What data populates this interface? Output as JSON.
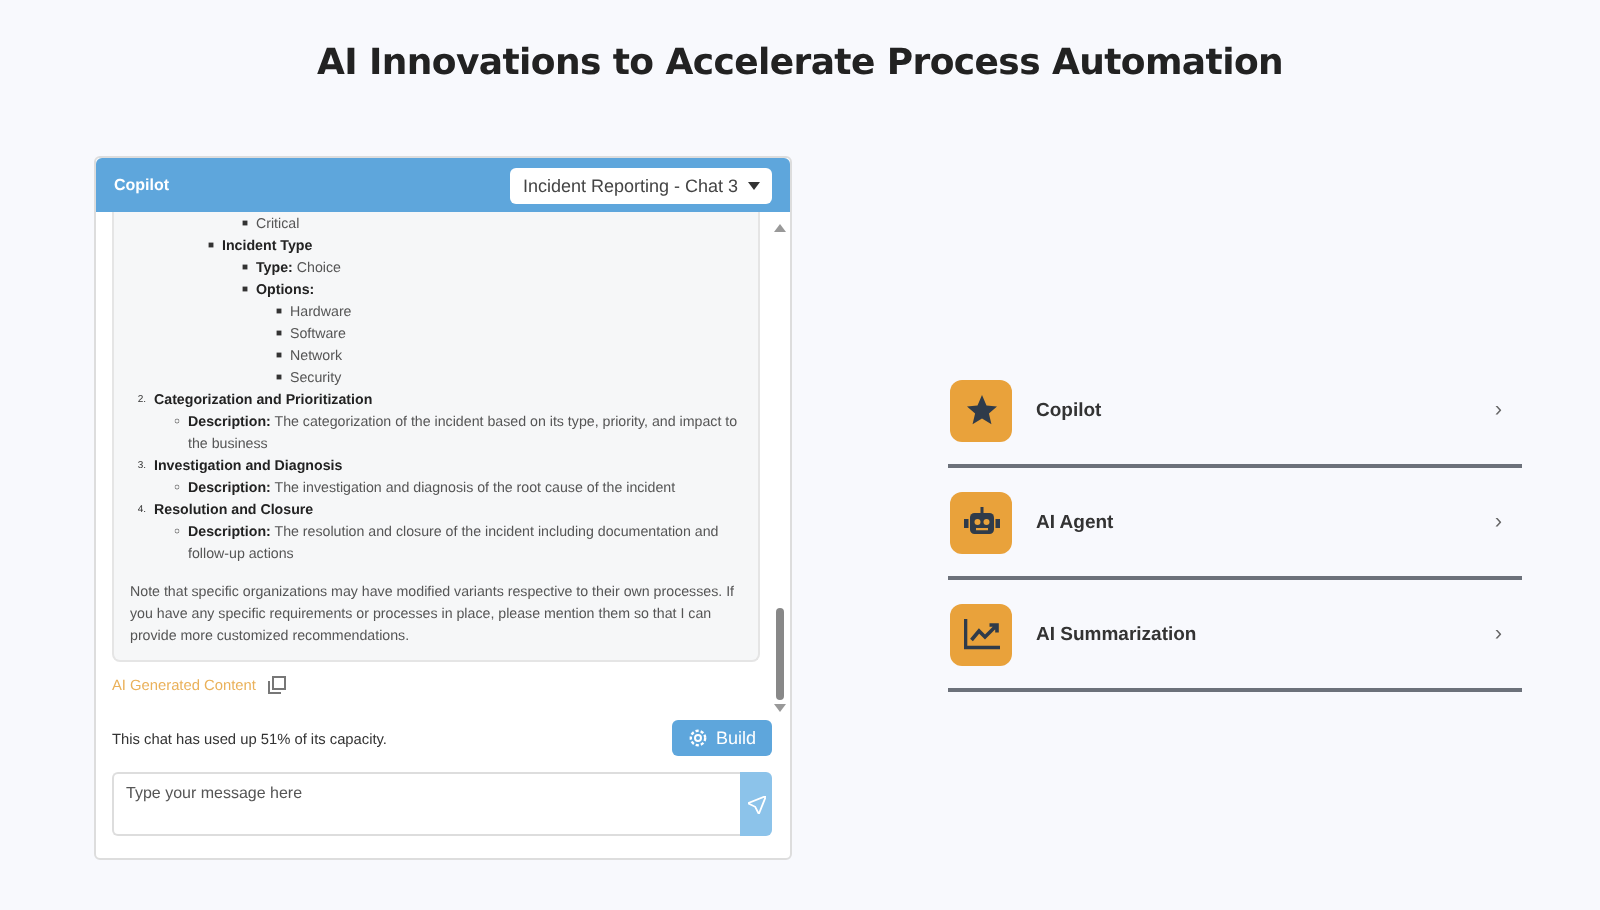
{
  "page_title": "AI Innovations to Accelerate Process Automation",
  "chat": {
    "title": "Copilot",
    "conversation": "Incident Reporting - Chat 3",
    "outline": [
      {
        "children": [
          {
            "children": [
              {
                "children": [
                  {
                    "kind": "detail",
                    "marker": "■",
                    "text": "Critical"
                  }
                ]
              },
              {
                "kind": "heading",
                "marker": "■",
                "text": "Incident Type",
                "children": [
                  {
                    "kind": "detail",
                    "marker": "■",
                    "text": "**Type:** Choice"
                  },
                  {
                    "kind": "heading",
                    "marker": "■",
                    "text": "Options:",
                    "children": [
                      {
                        "kind": "detail",
                        "marker": "■",
                        "text": "Hardware"
                      },
                      {
                        "kind": "detail",
                        "marker": "■",
                        "text": "Software"
                      },
                      {
                        "kind": "detail",
                        "marker": "■",
                        "text": "Network"
                      },
                      {
                        "kind": "detail",
                        "marker": "■",
                        "text": "Security"
                      }
                    ]
                  }
                ]
              }
            ]
          }
        ]
      },
      {
        "kind": "heading",
        "marker": "2.",
        "text": "Categorization and Prioritization",
        "children": [
          {
            "kind": "detail",
            "marker": "○",
            "text": "**Description:** The categorization of the incident based on its type, priority, and impact to the business"
          }
        ]
      },
      {
        "kind": "heading",
        "marker": "3.",
        "text": "Investigation and Diagnosis",
        "children": [
          {
            "kind": "detail",
            "marker": "○",
            "text": "**Description:** The investigation and diagnosis of the root cause of the incident"
          }
        ]
      },
      {
        "kind": "heading",
        "marker": "4.",
        "text": "Resolution and Closure",
        "children": [
          {
            "kind": "detail",
            "marker": "○",
            "text": "**Description:** The resolution and closure of the incident including documentation and follow-up actions"
          }
        ]
      }
    ],
    "note": "Note that specific organizations may have modified variants respective to their own processes. If you have any specific requirements or processes in place, please mention them so that I can provide more customized recommendations.",
    "ai_label": "AI Generated Content",
    "capacity": "This chat has used up 51% of its capacity.",
    "build_button": "Build",
    "input": {
      "placeholder": "Type your message here"
    }
  },
  "features": [
    {
      "kind": "star",
      "label": "Copilot",
      "chevron": "›"
    },
    {
      "kind": "robot",
      "label": "AI Agent",
      "chevron": "›"
    },
    {
      "kind": "chart",
      "label": "AI Summarization",
      "chevron": "›"
    }
  ]
}
